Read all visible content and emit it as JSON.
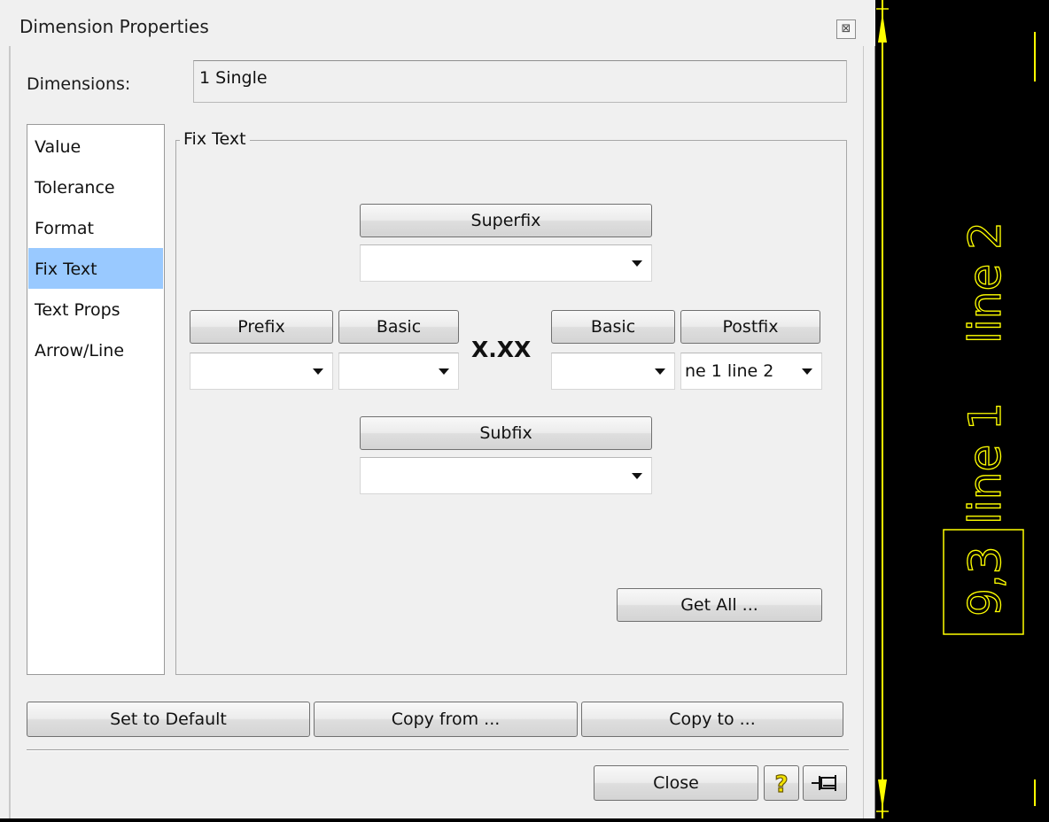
{
  "dialog": {
    "title": "Dimension Properties",
    "close_glyph": "⊠"
  },
  "dimensions": {
    "label": "Dimensions:",
    "value": "1 Single"
  },
  "nav": {
    "items": [
      {
        "label": "Value"
      },
      {
        "label": "Tolerance"
      },
      {
        "label": "Format"
      },
      {
        "label": "Fix Text",
        "selected": true
      },
      {
        "label": "Text Props"
      },
      {
        "label": "Arrow/Line"
      }
    ]
  },
  "fix_text": {
    "group_title": "Fix Text",
    "superfix_button": "Superfix",
    "superfix_value": "",
    "prefix_button": "Prefix",
    "prefix_value": "",
    "basic_left_button": "Basic",
    "basic_left_value": "",
    "value_placeholder": "X.XX",
    "basic_right_button": "Basic",
    "basic_right_value": "",
    "postfix_button": "Postfix",
    "postfix_value": "ne 1  line 2",
    "subfix_button": "Subfix",
    "subfix_value": "",
    "get_all_button": "Get All ..."
  },
  "footer": {
    "set_default_button": "Set to Default",
    "copy_from_button": "Copy from ...",
    "copy_to_button": "Copy to ...",
    "close_button": "Close",
    "help_icon": "help-icon",
    "pin_icon": "pin-icon"
  },
  "canvas": {
    "dimension_value": "9,3",
    "line1_text": "line 1",
    "line2_text": "line 2",
    "line_color": "#ffff00"
  },
  "colors": {
    "dialog_bg": "#f0f0f0",
    "selection": "#99c9ff",
    "cad_bg": "#000000",
    "cad_stroke": "#ffff00"
  }
}
